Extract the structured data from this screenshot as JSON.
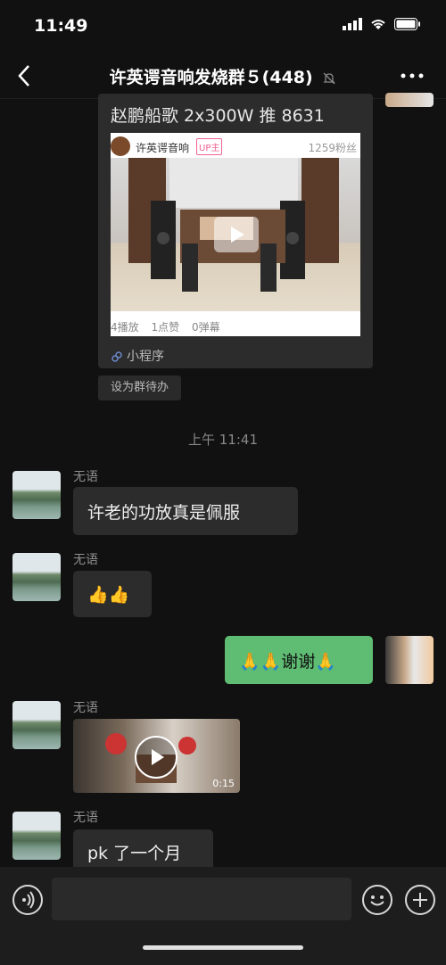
{
  "status": {
    "time": "11:49"
  },
  "nav": {
    "title": "许英谔音响发烧群５(448)"
  },
  "card": {
    "title": "赵鹏船歌 2x300W 推 8631",
    "uploader": "许英谔音响",
    "badge": "UP主",
    "fans": "1259粉丝",
    "stats": [
      "4播放",
      "1点赞",
      "0弹幕"
    ],
    "footer": "小程序"
  },
  "todo_label": "设为群待办",
  "timestamp": "上午 11:41",
  "messages": [
    {
      "sender": "无语",
      "text": "许老的功放真是佩服"
    },
    {
      "sender": "无语",
      "text": "👍👍"
    },
    {
      "sender": "me",
      "text": "🙏🙏谢谢🙏"
    },
    {
      "sender": "无语",
      "video_duration": "0:15"
    },
    {
      "sender": "无语",
      "text": "pk 了一个月"
    }
  ]
}
